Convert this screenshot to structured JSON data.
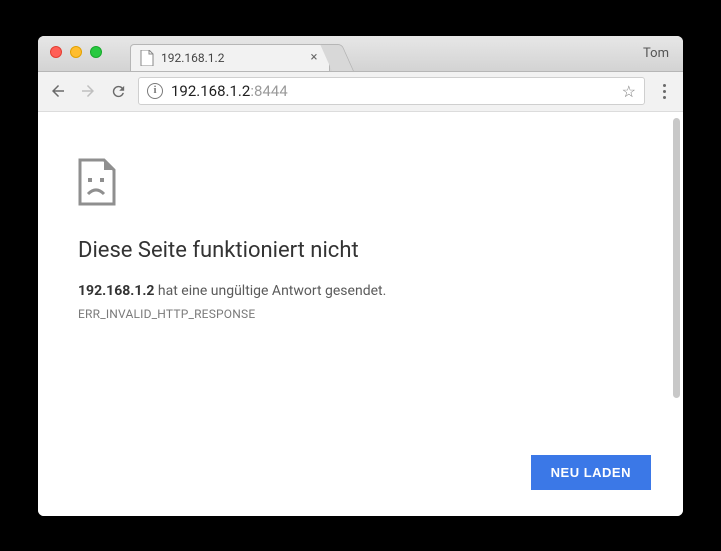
{
  "window": {
    "account_name": "Tom"
  },
  "tab": {
    "title": "192.168.1.2"
  },
  "address_bar": {
    "host": "192.168.1.2",
    "port": ":8444"
  },
  "error": {
    "title": "Diese Seite funktioniert nicht",
    "message_host": "192.168.1.2",
    "message_rest": " hat eine ungültige Antwort gesendet.",
    "code": "ERR_INVALID_HTTP_RESPONSE",
    "reload_label": "NEU LADEN"
  }
}
